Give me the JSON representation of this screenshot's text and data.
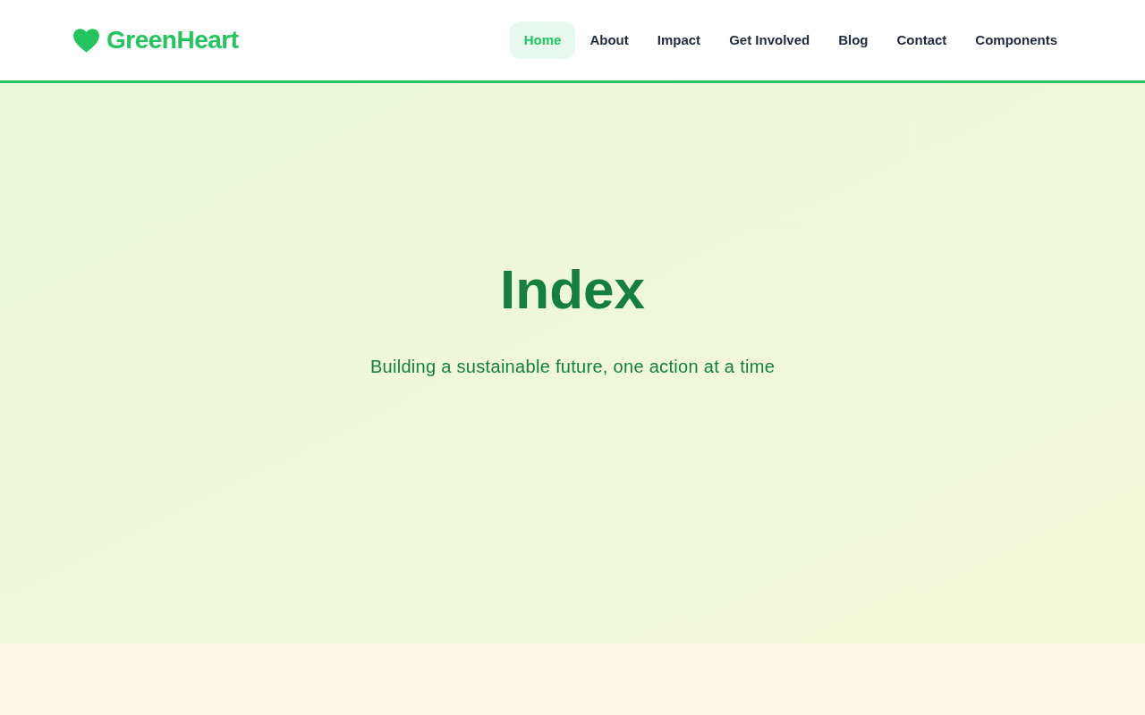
{
  "header": {
    "logo": "GreenHeart",
    "nav": [
      {
        "label": "Home",
        "selected": true
      },
      {
        "label": "About",
        "selected": false
      },
      {
        "label": "Impact",
        "selected": false
      },
      {
        "label": "Get Involved",
        "selected": false
      },
      {
        "label": "Blog",
        "selected": false
      },
      {
        "label": "Contact",
        "selected": false
      },
      {
        "label": "Components",
        "selected": false
      }
    ]
  },
  "hero": {
    "title": "Index",
    "subtitle": "Building a sustainable future, one action at a time"
  }
}
